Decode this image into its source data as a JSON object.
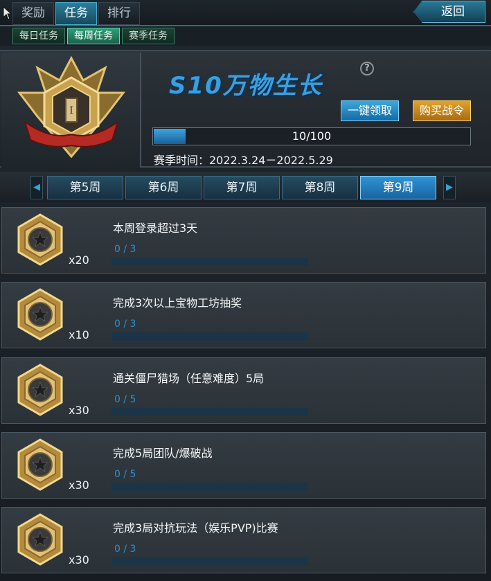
{
  "nav": {
    "tabs": [
      {
        "label": "奖励",
        "active": false
      },
      {
        "label": "任务",
        "active": true
      },
      {
        "label": "排行",
        "active": false
      }
    ],
    "back_label": "返回",
    "subtabs": [
      {
        "label": "每日任务",
        "active": false
      },
      {
        "label": "每周任务",
        "active": true
      },
      {
        "label": "赛季任务",
        "active": false
      }
    ]
  },
  "season": {
    "title": "S10万物生长",
    "rank_numeral": "I",
    "claim_all_label": "一键领取",
    "buy_pass_label": "购买战令",
    "progress_text": "10/100",
    "progress_value": 10,
    "progress_max": 100,
    "time_label": "赛季时间：2022.3.24－2022.5.29"
  },
  "weeks": {
    "tabs": [
      {
        "label": "第5周",
        "active": false
      },
      {
        "label": "第6周",
        "active": false
      },
      {
        "label": "第7周",
        "active": false
      },
      {
        "label": "第8周",
        "active": false
      },
      {
        "label": "第9周",
        "active": true
      }
    ]
  },
  "tasks": [
    {
      "title": "本周登录超过3天",
      "reward_count": "x20",
      "progress_text": "0 / 3",
      "current": 0,
      "target": 3
    },
    {
      "title": "完成3次以上宝物工坊抽奖",
      "reward_count": "x10",
      "progress_text": "0 / 3",
      "current": 0,
      "target": 3
    },
    {
      "title": "通关僵尸猎场（任意难度）5局",
      "reward_count": "x30",
      "progress_text": "0 / 5",
      "current": 0,
      "target": 5
    },
    {
      "title": "完成5局团队/爆破战",
      "reward_count": "x30",
      "progress_text": "0 / 5",
      "current": 0,
      "target": 5
    },
    {
      "title": "完成3局对抗玩法（娱乐PVP)比赛",
      "reward_count": "x30",
      "progress_text": "0 / 3",
      "current": 0,
      "target": 3
    }
  ],
  "colors": {
    "accent_blue": "#2d8fd0",
    "active_tab": "#2c7e9c",
    "subtab_green": "#2f9e77",
    "buy_gold": "#e2a32d",
    "medal_gold": "#d8b25a"
  },
  "icons": {
    "cursor": "cursor-arrow-icon",
    "back": "back-arrow-icon",
    "help": "question-mark-icon",
    "emblem": "rank-emblem-icon",
    "task_reward": "star-medal-icon",
    "week_prev": "left-arrow-icon",
    "week_next": "right-arrow-icon"
  }
}
